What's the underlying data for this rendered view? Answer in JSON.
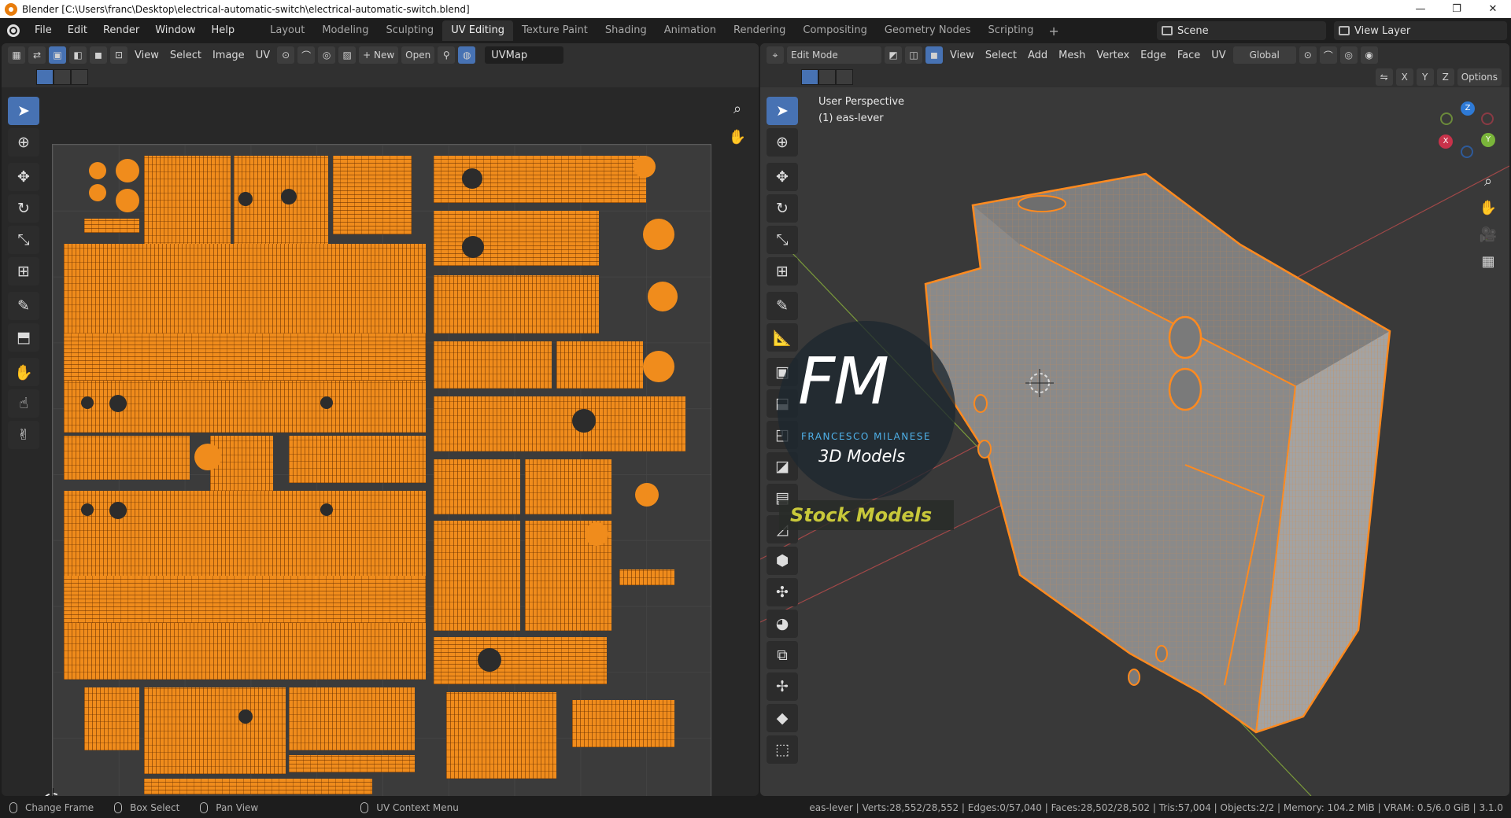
{
  "window": {
    "title": "Blender [C:\\Users\\franc\\Desktop\\electrical-automatic-switch\\electrical-automatic-switch.blend]",
    "minimize": "—",
    "maximize": "❐",
    "close": "✕"
  },
  "menu": [
    "File",
    "Edit",
    "Render",
    "Window",
    "Help"
  ],
  "workspaces": [
    "Layout",
    "Modeling",
    "Sculpting",
    "UV Editing",
    "Texture Paint",
    "Shading",
    "Animation",
    "Rendering",
    "Compositing",
    "Geometry Nodes",
    "Scripting"
  ],
  "active_workspace": "UV Editing",
  "scene": "Scene",
  "view_layer": "View Layer",
  "uv_editor": {
    "header_menu": [
      "View",
      "Select",
      "Image",
      "UV"
    ],
    "new_label": "+ New",
    "open_label": "Open",
    "uvmap": "UVMap"
  },
  "viewport": {
    "mode": "Edit Mode",
    "header_menu": [
      "View",
      "Select",
      "Add",
      "Mesh",
      "Vertex",
      "Edge",
      "Face",
      "UV"
    ],
    "orientation": "Global",
    "axes": [
      "X",
      "Y",
      "Z"
    ],
    "options": "Options",
    "overlay_line1": "User Perspective",
    "overlay_line2": "(1) eas-lever",
    "gizmo": {
      "x": "X",
      "y": "Y",
      "z": "Z"
    }
  },
  "watermark": {
    "fm": "FM",
    "name": "FRANCESCO MILANESE",
    "sub": "3D Models",
    "stock": "Stock Models"
  },
  "status": {
    "left": [
      "Change Frame",
      "Box Select",
      "Pan View"
    ],
    "context": "UV Context Menu",
    "stats": "eas-lever | Verts:28,552/28,552 | Edges:0/57,040 | Faces:28,502/28,502 | Tris:57,004 | Objects:2/2 | Memory: 104.2 MiB | VRAM: 0.5/6.0 GiB | 3.1.0"
  },
  "colors": {
    "accent": "#4772b3",
    "uv_orange": "#f08c1c",
    "mesh_orange": "#ff8a1f"
  }
}
